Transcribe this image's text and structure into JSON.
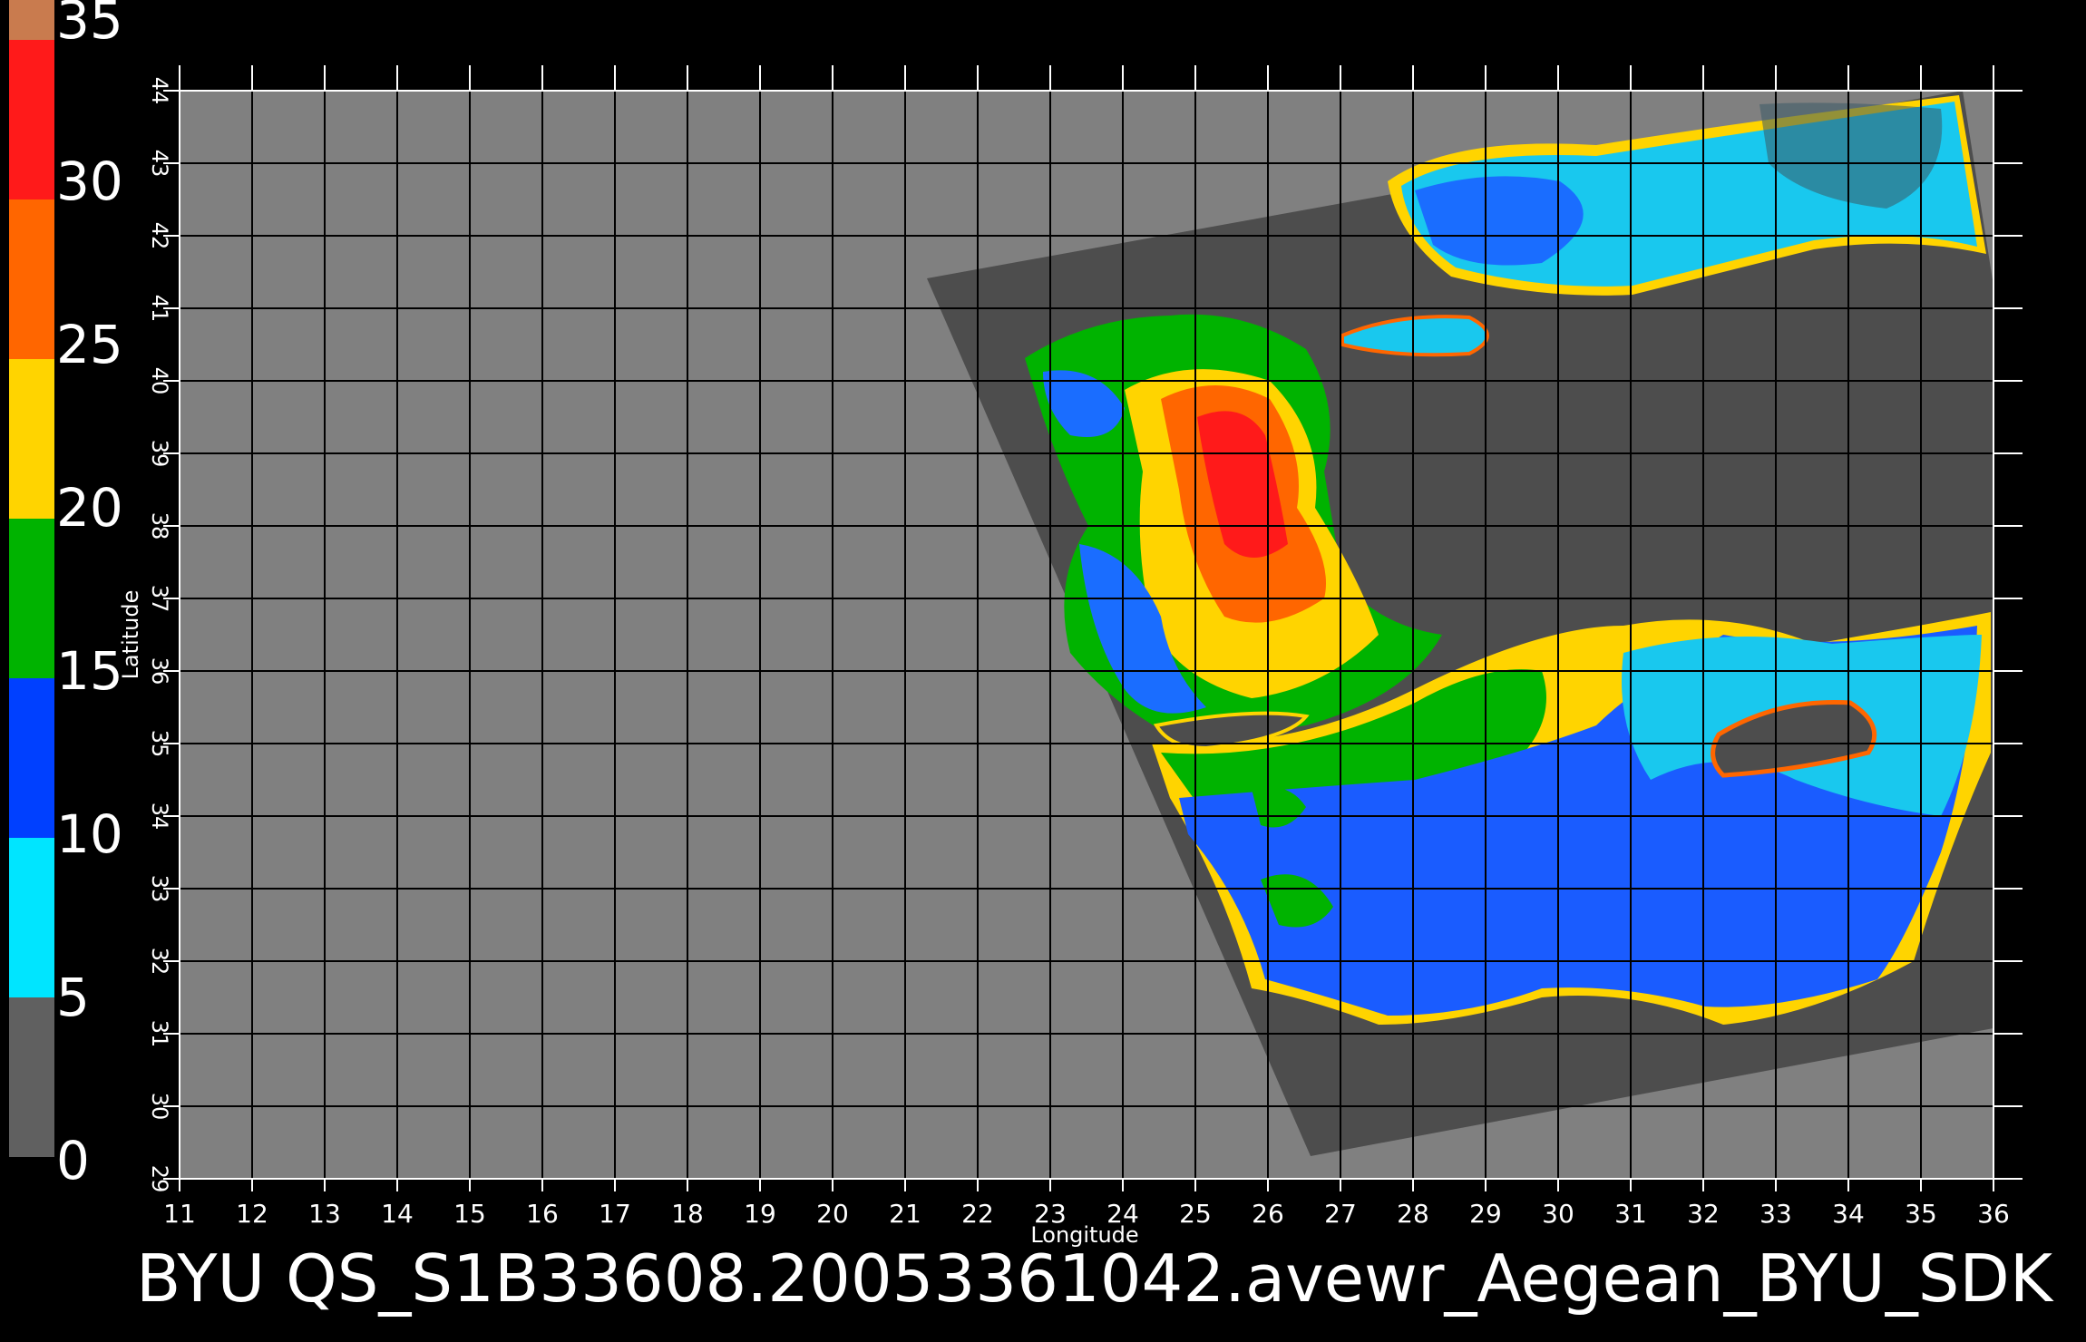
{
  "colorbar": {
    "labels": [
      "35",
      "30",
      "25",
      "20",
      "15",
      "10",
      "5",
      "0"
    ],
    "colors": [
      "#c97b4e",
      "#ff1a1a",
      "#ff6600",
      "#ffd400",
      "#00b300",
      "#0040ff",
      "#00e5ff",
      "#606060"
    ]
  },
  "axes": {
    "x_ticks": [
      "11",
      "12",
      "13",
      "14",
      "15",
      "16",
      "17",
      "18",
      "19",
      "20",
      "21",
      "22",
      "23",
      "24",
      "25",
      "26",
      "27",
      "28",
      "29",
      "30",
      "31",
      "32",
      "33",
      "34",
      "35",
      "36"
    ],
    "y_ticks": [
      "29",
      "30",
      "31",
      "32",
      "33",
      "34",
      "35",
      "36",
      "37",
      "38",
      "39",
      "40",
      "41",
      "42",
      "43",
      "44"
    ],
    "xlabel": "Longitude",
    "ylabel": "Latitude",
    "xlim": [
      11,
      36
    ],
    "ylim": [
      29,
      44
    ],
    "grid": true
  },
  "title": "BYU  QS_S1B33608.20053361042.avewr_Aegean_BYU_SDK",
  "colors": {
    "background": "#000000",
    "land": "#808080",
    "swath": "#4d4d4d",
    "grid": "#000000"
  }
}
